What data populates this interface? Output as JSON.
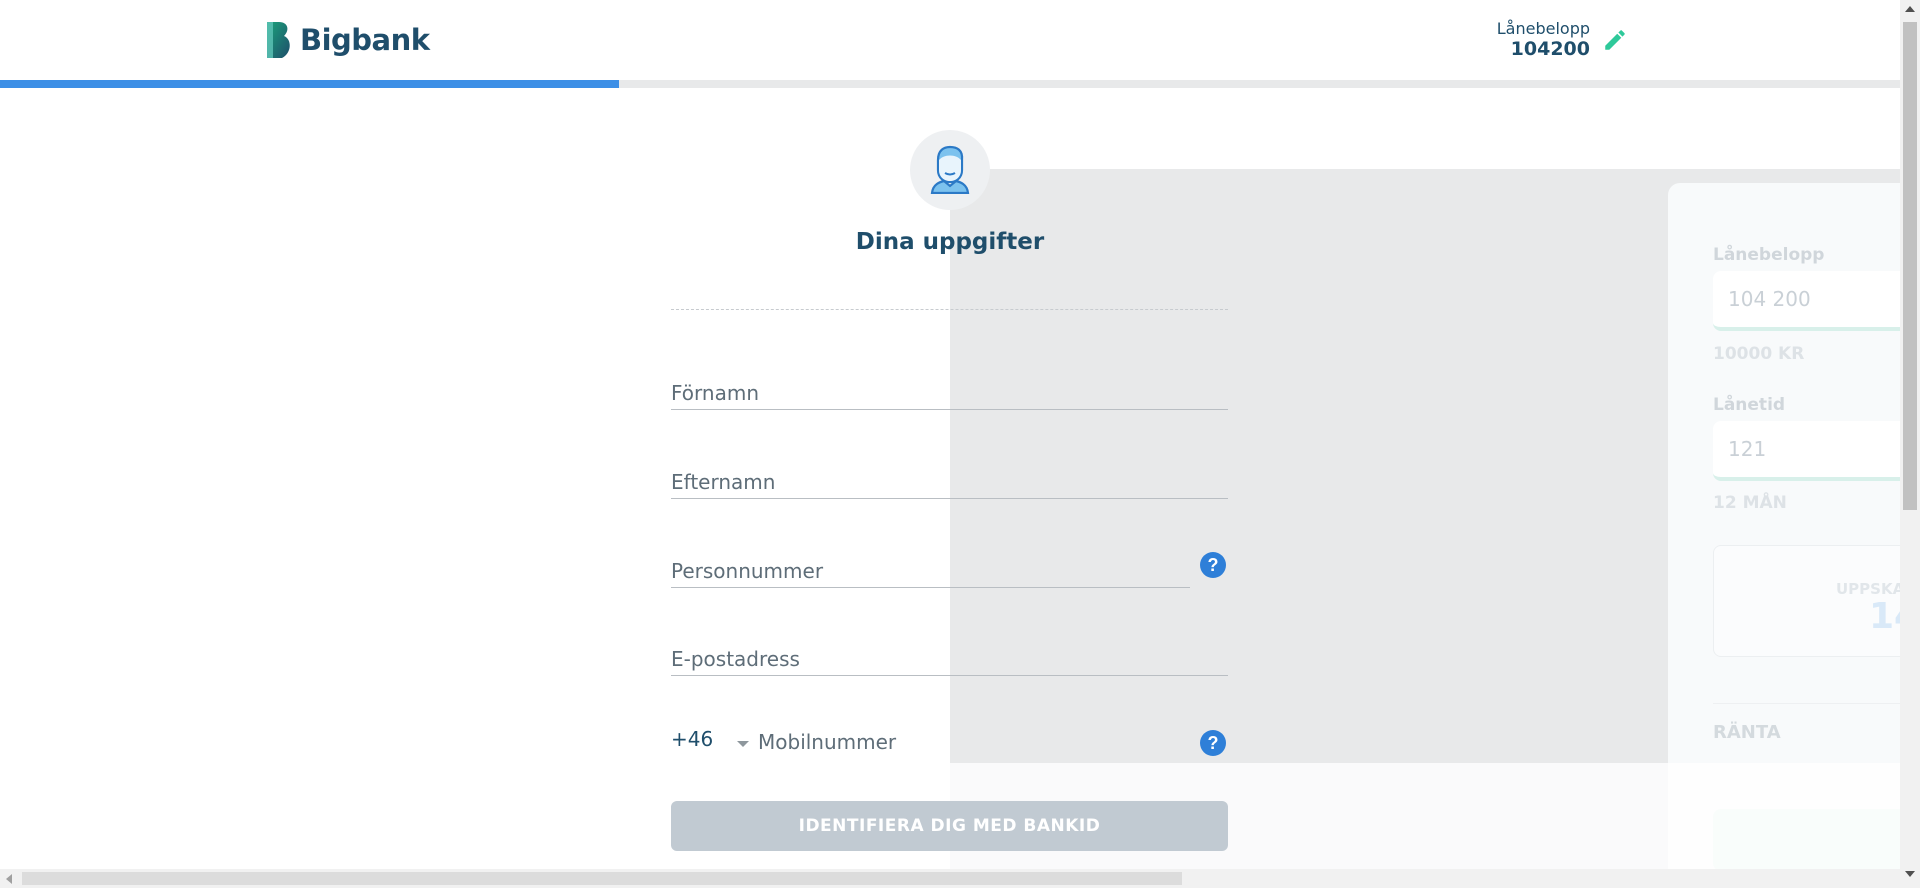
{
  "header": {
    "brand": "Bigbank",
    "loan_amount_label": "Lånebelopp",
    "loan_amount_value": "104200",
    "progress_percent": 32.6
  },
  "calculator": {
    "amount_label": "Lånebelopp",
    "amount_value": "104 200",
    "amount_min_hint": "10000 KR",
    "term_label": "Lånetid",
    "term_value": "121",
    "term_min_hint": "12 MÅN",
    "monthly_label": "UPPSKA",
    "monthly_value": "14",
    "rate_label": "RÄNTA"
  },
  "form": {
    "title": "Dina uppgifter",
    "first_name_placeholder": "Förnamn",
    "last_name_placeholder": "Efternamn",
    "personal_number_placeholder": "Personnummer",
    "email_placeholder": "E-postadress",
    "phone_prefix": "+46",
    "phone_placeholder": "Mobilnummer",
    "help_symbol": "?",
    "submit_label": "IDENTIFIERA DIG MED BANKID"
  },
  "colors": {
    "brand_dark": "#1f4e6b",
    "accent_green": "#2ec99a",
    "progress_blue": "#3d8fe6",
    "help_blue": "#2e7fd8",
    "button_disabled": "#c1cad2"
  },
  "icons": {
    "logo": "bigbank-logo-icon",
    "edit": "pencil-icon",
    "avatar": "user-avatar-icon",
    "help": "question-mark-icon",
    "dropdown": "caret-down-icon"
  }
}
